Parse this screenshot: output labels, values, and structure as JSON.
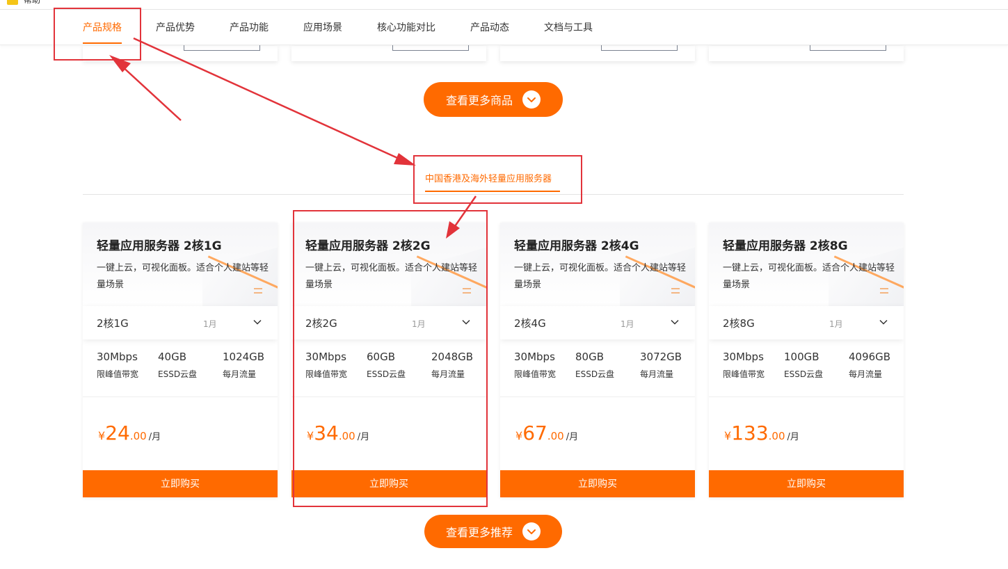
{
  "topbar": {
    "label": "帮助"
  },
  "nav": {
    "items": [
      {
        "label": "产品规格",
        "active": true
      },
      {
        "label": "产品优势"
      },
      {
        "label": "产品功能"
      },
      {
        "label": "应用场景"
      },
      {
        "label": "核心功能对比"
      },
      {
        "label": "产品动态"
      },
      {
        "label": "文档与工具"
      }
    ]
  },
  "more_products_button": "查看更多商品",
  "tab": {
    "label": "中国香港及海外轻量应用服务器"
  },
  "products": [
    {
      "title": "轻量应用服务器 2核1G",
      "desc": "一键上云，可视化面板。适合个人建站等轻量场景",
      "spec": "2核1G",
      "period": "1月",
      "bandwidth": "30Mbps",
      "bandwidth_label": "限峰值带宽",
      "disk": "40GB",
      "disk_label": "ESSD云盘",
      "traffic": "1024GB",
      "traffic_label": "每月流量",
      "currency": "¥",
      "price_int": "24",
      "price_dec": ".00",
      "price_unit": "/月",
      "buy_label": "立即购买"
    },
    {
      "title": "轻量应用服务器 2核2G",
      "desc": "一键上云，可视化面板。适合个人建站等轻量场景",
      "spec": "2核2G",
      "period": "1月",
      "bandwidth": "30Mbps",
      "bandwidth_label": "限峰值带宽",
      "disk": "60GB",
      "disk_label": "ESSD云盘",
      "traffic": "2048GB",
      "traffic_label": "每月流量",
      "currency": "¥",
      "price_int": "34",
      "price_dec": ".00",
      "price_unit": "/月",
      "buy_label": "立即购买"
    },
    {
      "title": "轻量应用服务器 2核4G",
      "desc": "一键上云，可视化面板。适合个人建站等轻量场景",
      "spec": "2核4G",
      "period": "1月",
      "bandwidth": "30Mbps",
      "bandwidth_label": "限峰值带宽",
      "disk": "80GB",
      "disk_label": "ESSD云盘",
      "traffic": "3072GB",
      "traffic_label": "每月流量",
      "currency": "¥",
      "price_int": "67",
      "price_dec": ".00",
      "price_unit": "/月",
      "buy_label": "立即购买"
    },
    {
      "title": "轻量应用服务器 2核8G",
      "desc": "一键上云，可视化面板。适合个人建站等轻量场景",
      "spec": "2核8G",
      "period": "1月",
      "bandwidth": "30Mbps",
      "bandwidth_label": "限峰值带宽",
      "disk": "100GB",
      "disk_label": "ESSD云盘",
      "traffic": "4096GB",
      "traffic_label": "每月流量",
      "currency": "¥",
      "price_int": "133",
      "price_dec": ".00",
      "price_unit": "/月",
      "buy_label": "立即购买"
    }
  ],
  "more_recommend_button": "查看更多推荐",
  "colors": {
    "accent": "#ff6a00",
    "annotation": "#e2333a"
  }
}
